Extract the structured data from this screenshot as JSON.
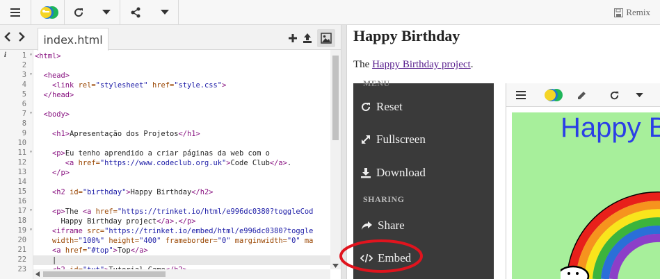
{
  "toolbar": {
    "remix_label": "Remix"
  },
  "editor": {
    "file_tab": "index.html",
    "gutter_info": "i",
    "lines": [
      {
        "n": "1",
        "fold": true,
        "parts": [
          [
            "tag",
            "<html>"
          ]
        ]
      },
      {
        "n": "2",
        "parts": []
      },
      {
        "n": "3",
        "fold": true,
        "parts": [
          [
            "txt",
            "  "
          ],
          [
            "tag",
            "<head>"
          ]
        ]
      },
      {
        "n": "4",
        "parts": [
          [
            "txt",
            "    "
          ],
          [
            "tag",
            "<link "
          ],
          [
            "attr",
            "rel="
          ],
          [
            "val",
            "\"stylesheet\""
          ],
          [
            "attr",
            " href="
          ],
          [
            "val",
            "\"style.css\""
          ],
          [
            "tag",
            ">"
          ]
        ]
      },
      {
        "n": "5",
        "parts": [
          [
            "txt",
            "  "
          ],
          [
            "tag",
            "</head>"
          ]
        ]
      },
      {
        "n": "6",
        "parts": []
      },
      {
        "n": "7",
        "fold": true,
        "parts": [
          [
            "txt",
            "  "
          ],
          [
            "tag",
            "<body>"
          ]
        ]
      },
      {
        "n": "8",
        "parts": []
      },
      {
        "n": "9",
        "parts": [
          [
            "txt",
            "    "
          ],
          [
            "tag",
            "<h1>"
          ],
          [
            "txt",
            "Apresentação dos Projetos"
          ],
          [
            "tag",
            "</h1>"
          ]
        ]
      },
      {
        "n": "10",
        "parts": []
      },
      {
        "n": "11",
        "fold": true,
        "parts": [
          [
            "txt",
            "    "
          ],
          [
            "tag",
            "<p>"
          ],
          [
            "txt",
            "Eu tenho aprendido a criar páginas da web com o"
          ]
        ]
      },
      {
        "n": "12",
        "parts": [
          [
            "txt",
            "       "
          ],
          [
            "tag",
            "<a "
          ],
          [
            "attr",
            "href="
          ],
          [
            "val",
            "\"https://www.codeclub.org.uk\""
          ],
          [
            "tag",
            ">"
          ],
          [
            "txt",
            "Code Club"
          ],
          [
            "tag",
            "</a>"
          ],
          [
            "txt",
            "."
          ]
        ]
      },
      {
        "n": "13",
        "parts": [
          [
            "txt",
            "    "
          ],
          [
            "tag",
            "</p>"
          ]
        ]
      },
      {
        "n": "14",
        "parts": []
      },
      {
        "n": "15",
        "parts": [
          [
            "txt",
            "    "
          ],
          [
            "tag",
            "<h2 "
          ],
          [
            "attr",
            "id="
          ],
          [
            "val",
            "\"birthday\""
          ],
          [
            "tag",
            ">"
          ],
          [
            "txt",
            "Happy Birthday"
          ],
          [
            "tag",
            "</h2>"
          ]
        ]
      },
      {
        "n": "16",
        "parts": []
      },
      {
        "n": "17",
        "fold": true,
        "parts": [
          [
            "txt",
            "    "
          ],
          [
            "tag",
            "<p>"
          ],
          [
            "txt",
            "The "
          ],
          [
            "tag",
            "<a "
          ],
          [
            "attr",
            "href="
          ],
          [
            "val",
            "\"https://trinket.io/html/e996dc0380?toggleCod"
          ]
        ]
      },
      {
        "n": "18",
        "parts": [
          [
            "txt",
            "      Happy Birthday project"
          ],
          [
            "tag",
            "</a>"
          ],
          [
            "txt",
            "."
          ],
          [
            "tag",
            "</p>"
          ]
        ]
      },
      {
        "n": "19",
        "fold": true,
        "parts": [
          [
            "txt",
            "    "
          ],
          [
            "tag",
            "<iframe "
          ],
          [
            "attr",
            "src="
          ],
          [
            "val",
            "\"https://trinket.io/embed/html/e996dc0380?toggle"
          ]
        ]
      },
      {
        "n": "20",
        "parts": [
          [
            "attr",
            "    width="
          ],
          [
            "val",
            "\"100%\""
          ],
          [
            "attr",
            " height="
          ],
          [
            "val",
            "\"400\""
          ],
          [
            "attr",
            " frameborder="
          ],
          [
            "val",
            "\"0\""
          ],
          [
            "attr",
            " marginwidth="
          ],
          [
            "val",
            "\"0\""
          ],
          [
            "attr",
            " ma"
          ]
        ]
      },
      {
        "n": "21",
        "parts": [
          [
            "txt",
            "    "
          ],
          [
            "tag",
            "<a "
          ],
          [
            "attr",
            "href="
          ],
          [
            "val",
            "\"#top\""
          ],
          [
            "tag",
            ">"
          ],
          [
            "txt",
            "Top"
          ],
          [
            "tag",
            "</a>"
          ]
        ]
      },
      {
        "n": "22",
        "highlight": true,
        "parts": [
          [
            "txt",
            "    |"
          ]
        ]
      },
      {
        "n": "23",
        "parts": [
          [
            "txt",
            "    "
          ],
          [
            "tag",
            "<h2 "
          ],
          [
            "attr",
            "id="
          ],
          [
            "val",
            "\"tut\""
          ],
          [
            "tag",
            ">"
          ],
          [
            "txt",
            "Tutorial Game"
          ],
          [
            "tag",
            "</h2>"
          ]
        ]
      }
    ]
  },
  "preview": {
    "title": "Happy Birthday",
    "text_before": "The ",
    "link_text": "Happy Birthday project",
    "text_after": ".",
    "menu_header_top": "MENU",
    "menu_items": [
      "Reset",
      "Fullscreen",
      "Download"
    ],
    "sharing_header": "SHARING",
    "share_items": [
      "Share",
      "Embed"
    ],
    "embed_title": "Happy B",
    "highlight_color": "#e0141e"
  }
}
